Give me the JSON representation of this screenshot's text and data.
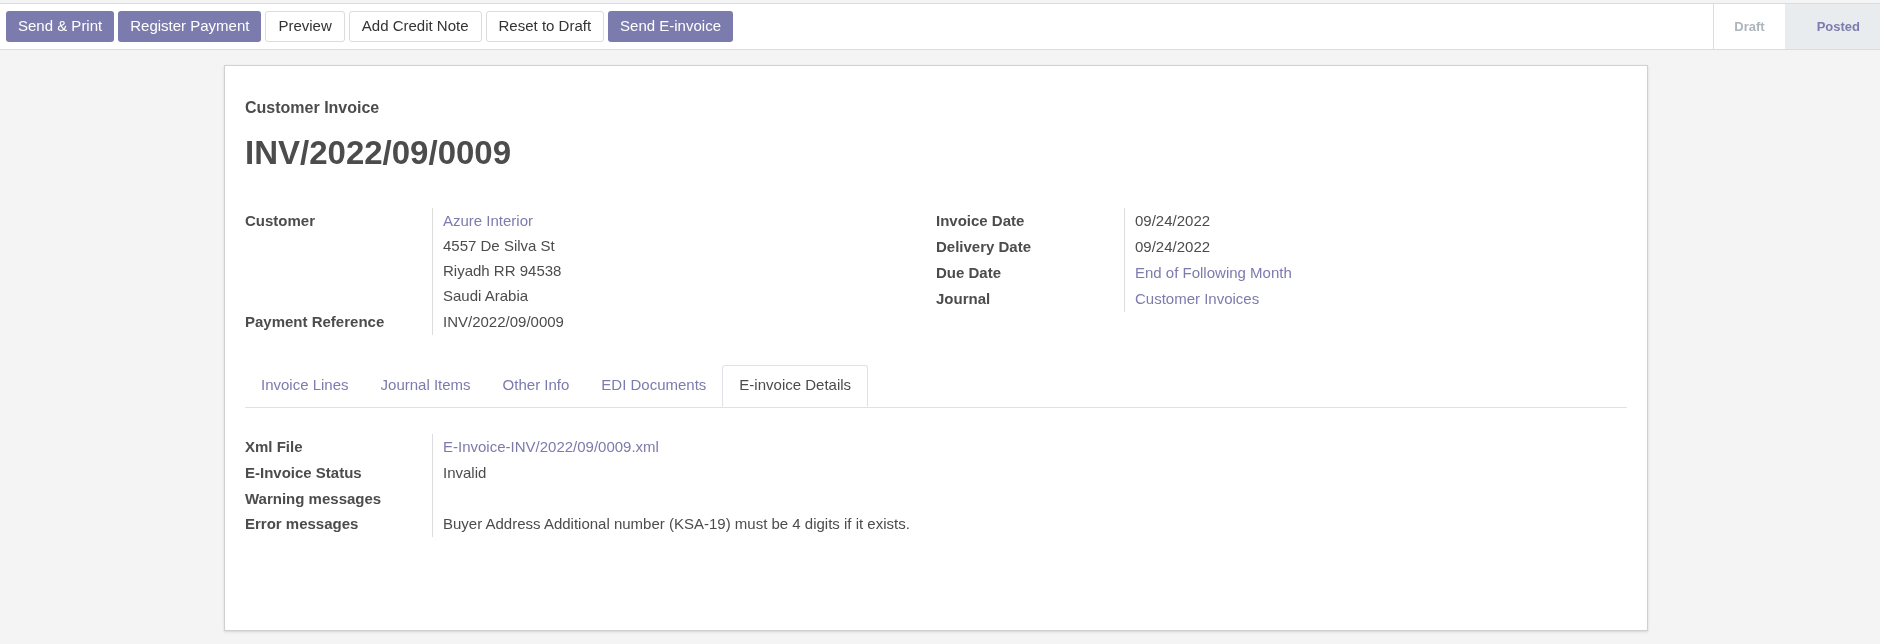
{
  "buttons": [
    {
      "label": "Send & Print",
      "kind": "primary"
    },
    {
      "label": "Register Payment",
      "kind": "primary"
    },
    {
      "label": "Preview",
      "kind": "secondary"
    },
    {
      "label": "Add Credit Note",
      "kind": "secondary"
    },
    {
      "label": "Reset to Draft",
      "kind": "secondary"
    },
    {
      "label": "Send E-invoice",
      "kind": "primary"
    }
  ],
  "stages": [
    {
      "label": "Draft",
      "selected": false
    },
    {
      "label": "Posted",
      "selected": true
    }
  ],
  "form": {
    "subtitle": "Customer Invoice",
    "title": "INV/2022/09/0009",
    "left_fields": [
      {
        "label": "Customer",
        "lines": [
          {
            "text": "Azure Interior",
            "kind": "link"
          },
          {
            "text": "4557 De Silva St",
            "kind": "text"
          },
          {
            "text": "Riyadh RR 94538",
            "kind": "text"
          },
          {
            "text": "Saudi Arabia",
            "kind": "text"
          }
        ]
      },
      {
        "label": "Payment Reference",
        "lines": [
          {
            "text": "INV/2022/09/0009",
            "kind": "text"
          }
        ]
      }
    ],
    "right_fields": [
      {
        "label": "Invoice Date",
        "lines": [
          {
            "text": "09/24/2022",
            "kind": "text"
          }
        ]
      },
      {
        "label": "Delivery Date",
        "lines": [
          {
            "text": "09/24/2022",
            "kind": "text"
          }
        ]
      },
      {
        "label": "Due Date",
        "lines": [
          {
            "text": "End of Following Month",
            "kind": "link"
          }
        ]
      },
      {
        "label": "Journal",
        "lines": [
          {
            "text": "Customer Invoices",
            "kind": "link"
          }
        ]
      }
    ],
    "tabs": [
      {
        "label": "Invoice Lines",
        "selected": false
      },
      {
        "label": "Journal Items",
        "selected": false
      },
      {
        "label": "Other Info",
        "selected": false
      },
      {
        "label": "EDI Documents",
        "selected": false
      },
      {
        "label": "E-invoice Details",
        "selected": true
      }
    ],
    "tab_fields": [
      {
        "label": "Xml File",
        "lines": [
          {
            "text": "E-Invoice-INV/2022/09/0009.xml",
            "kind": "link"
          }
        ]
      },
      {
        "label": "E-Invoice Status",
        "lines": [
          {
            "text": "Invalid",
            "kind": "text"
          }
        ]
      },
      {
        "label": "Warning messages"
      },
      {
        "label": "Error messages",
        "lines": [
          {
            "text": "Buyer Address Additional number (KSA-19) must be 4 digits if it exists.",
            "kind": "text"
          }
        ]
      }
    ]
  }
}
